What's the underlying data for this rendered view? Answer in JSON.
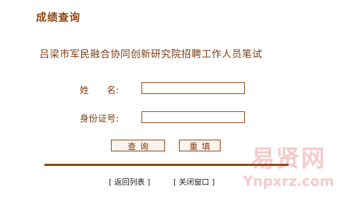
{
  "header": {
    "title": "成绩查询"
  },
  "exam": {
    "name": "吕梁市军民融合协同创新研究院招聘工作人员笔试"
  },
  "form": {
    "name_label_part1": "姓",
    "name_label_part2": "名:",
    "name_value": "",
    "id_label": "身份证号:",
    "id_value": ""
  },
  "buttons": {
    "query": "查询",
    "reset": "重填"
  },
  "footer": {
    "back_link": "[ 返回列表 ]",
    "close_link": "[ 关闭窗口 ]"
  },
  "watermark": {
    "text_cn": "易贤网",
    "text_en": "Ynpxrz.com"
  },
  "colors": {
    "accent": "#8a4512",
    "text": "#7a3a10",
    "background": "#ffffff"
  }
}
